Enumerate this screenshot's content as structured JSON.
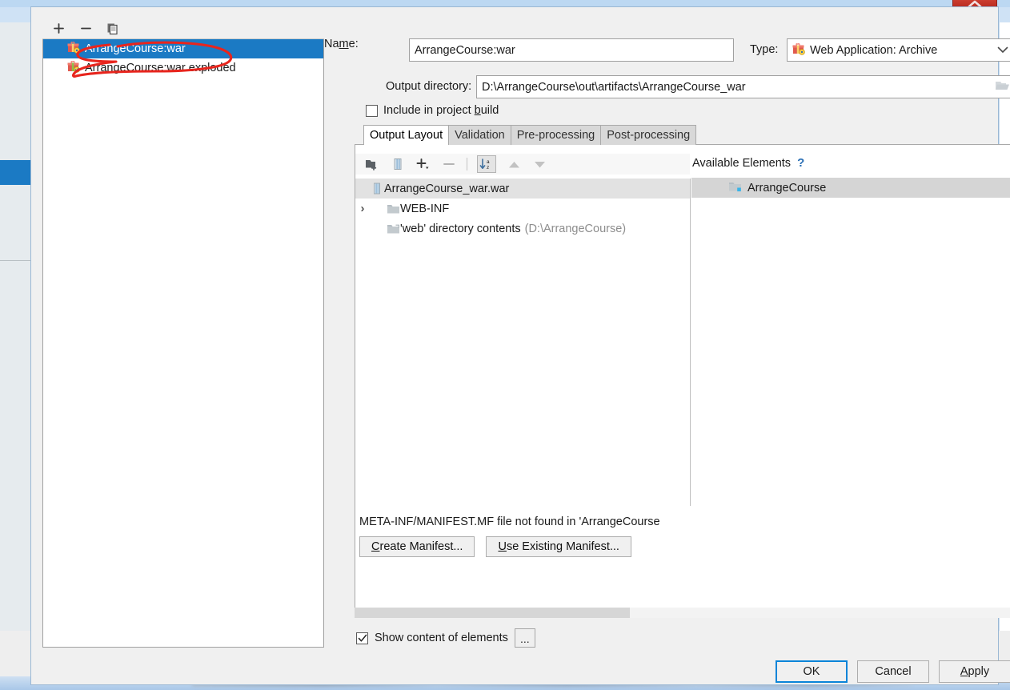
{
  "window": {
    "close_button_icon": "close-chevron-icon"
  },
  "artifacts_panel": {
    "toolbar": [
      {
        "icon": "plus-icon",
        "label": "+"
      },
      {
        "icon": "minus-icon",
        "label": "−"
      },
      {
        "icon": "copy-icon",
        "label": "copy"
      }
    ],
    "items": [
      {
        "label": "ArrangeCourse:war",
        "icon": "artifact-archive-icon",
        "selected": true
      },
      {
        "label": "ArrangeCourse:war exploded",
        "icon": "artifact-exploded-icon",
        "selected": false
      }
    ],
    "annotation": "red-ink-ellipse"
  },
  "form": {
    "name_label": "Na",
    "name_label_underlined": "m",
    "name_label_rest": "e:",
    "name_value": "ArrangeCourse:war",
    "type_label": "Type:",
    "type_value": "Web Application: Archive",
    "type_icon": "artifact-archive-icon",
    "output_directory_label": "Output directory:",
    "output_directory_value": "D:\\ArrangeCourse\\out\\artifacts\\ArrangeCourse_war",
    "browse_icon": "folder-open-icon",
    "include_in_build_label_a": "Include in project ",
    "include_in_build_label_u": "b",
    "include_in_build_label_b": "uild",
    "include_in_build_checked": false
  },
  "tabs": [
    {
      "label": "Output Layout",
      "active": true
    },
    {
      "label": "Validation",
      "active": false
    },
    {
      "label": "Pre-processing",
      "active": false
    },
    {
      "label": "Post-processing",
      "active": false
    }
  ],
  "output_layout": {
    "toolbar": [
      {
        "icon": "add-directory-icon"
      },
      {
        "icon": "add-archive-icon"
      },
      {
        "icon": "plus-dropdown-icon"
      },
      {
        "icon": "minus-icon"
      },
      {
        "icon": "sort-alphabetical-icon"
      },
      {
        "icon": "move-up-icon"
      },
      {
        "icon": "move-down-icon"
      }
    ],
    "tree": [
      {
        "label": "ArrangeCourse_war.war",
        "icon": "archive-icon",
        "indent": 0,
        "header": true,
        "expander": ""
      },
      {
        "label": "WEB-INF",
        "icon": "folder-icon",
        "indent": 1,
        "header": false,
        "expander": "›"
      },
      {
        "label": "'web' directory contents",
        "suffix": "(D:\\ArrangeCourse)",
        "icon": "folder-link-icon",
        "indent": 1,
        "header": false,
        "expander": ""
      }
    ],
    "manifest_message": "META-INF/MANIFEST.MF file not found in 'ArrangeCourse",
    "create_manifest_label_u": "C",
    "create_manifest_label_rest": "reate Manifest...",
    "use_existing_label_u": "U",
    "use_existing_label_rest": "se Existing Manifest...",
    "show_content_label": "Show content of elements",
    "show_content_checked": true,
    "ellipsis_button_label": "..."
  },
  "available_elements": {
    "title": "Available Elements",
    "help_icon": "help-question-icon",
    "items": [
      {
        "label": "ArrangeCourse",
        "icon": "module-folder-icon"
      }
    ]
  },
  "footer": {
    "ok_label": "OK",
    "cancel_label": "Cancel",
    "apply_label_u": "A",
    "apply_label_rest": "pply"
  },
  "colors": {
    "selection_blue": "#1b7ac4",
    "focus_blue": "#0a84d8",
    "annotation_red": "#e8251d",
    "dialog_bg": "#f0f0f0"
  }
}
